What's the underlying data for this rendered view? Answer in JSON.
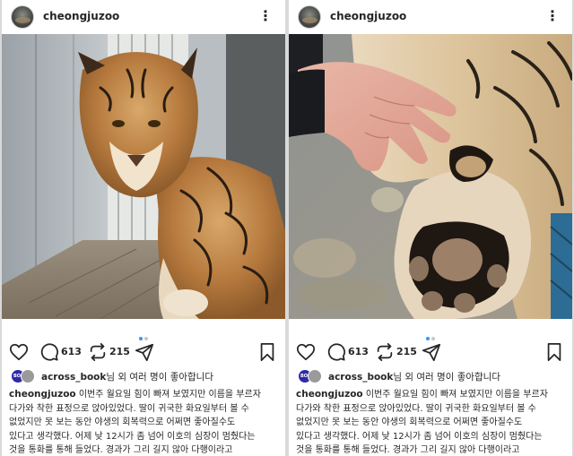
{
  "posts": [
    {
      "username": "cheongjuzoo",
      "more_icon": "more-vertical-icon",
      "photo": "tiger standing inside an indoor enclosure",
      "comments": "613",
      "reposts": "215",
      "liked_by_user": "across_book",
      "liked_by_suffix": "님 외 여러 명이 좋아합니다",
      "caption_username": "cheongjuzoo",
      "caption_lines": [
        " 이번주 월요일 힘이 빠져 보였지만 이름을 부르자",
        "다가와 착한 표정으로 앉아있었다. 딸이 귀국한 화요일부터 볼 수",
        "없었지만 못 보는 동안 야생의 회복력으로 어쩌면 좋아질수도",
        "있다고 생각했다. 어제 낮 12시가 좀 넘어 이호의 심장이 멈췄다는",
        "것을 통화를 통해 들었다. 경과가 그리 길지 않아 다행이라고"
      ]
    },
    {
      "username": "cheongjuzoo",
      "more_icon": "more-vertical-icon",
      "photo": "human hand next to a tiger paw",
      "comments": "613",
      "reposts": "215",
      "liked_by_user": "across_book",
      "liked_by_suffix": "님 외 여러 명이 좋아합니다",
      "caption_username": "cheongjuzoo",
      "caption_lines": [
        " 이번주 월요일 힘이 빠져 보였지만 이름을 부르자",
        "다가와 착한 표정으로 앉아있었다. 딸이 귀국한 화요일부터 볼 수",
        "없었지만 못 보는 동안 야생의 회복력으로 어쩌면 좋아질수도",
        "있다고 생각했다. 어제 낮 12시가 좀 넘어 이호의 심장이 멈췄다는",
        "것을 통화를 통해 들었다. 경과가 그리 길지 않아 다행이라고"
      ]
    }
  ],
  "icons": {
    "like": "heart-icon",
    "comment": "comment-icon",
    "repost": "repost-icon",
    "share": "send-icon",
    "save": "bookmark-icon"
  },
  "colors": {
    "text": "#262626",
    "carousel_active": "#3897f0",
    "carousel_inactive": "#c7c7c7"
  }
}
